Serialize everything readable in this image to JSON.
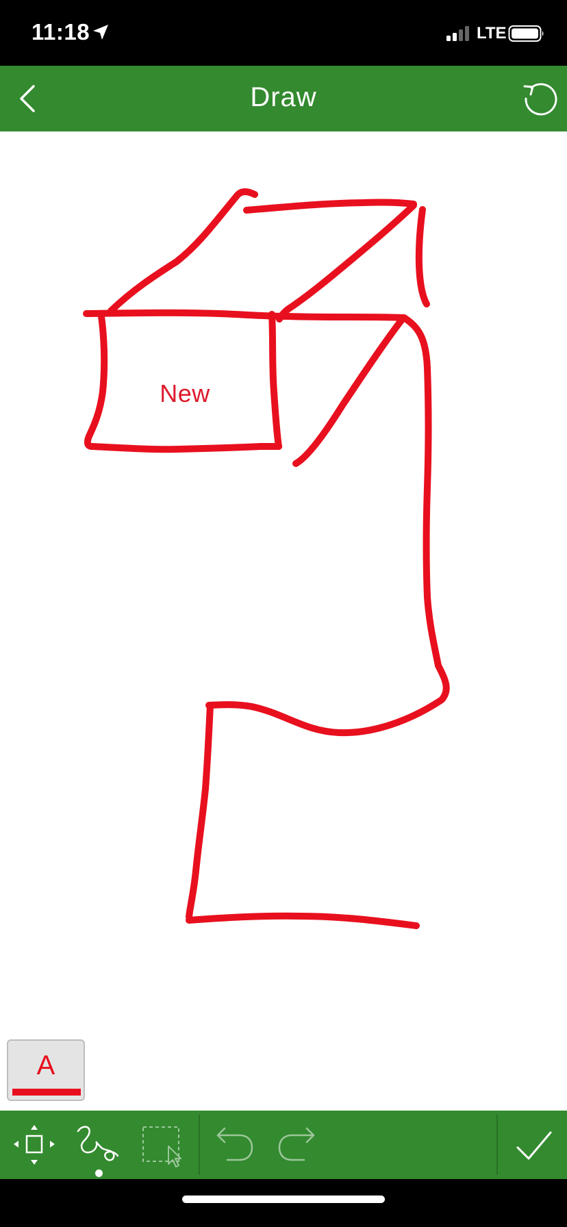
{
  "status_bar": {
    "time": "11:18",
    "network": "LTE",
    "location_icon": "location-arrow-icon",
    "signal_icon": "signal-bars-icon",
    "battery_icon": "battery-icon"
  },
  "header": {
    "title": "Draw",
    "back_icon": "chevron-left-icon",
    "reset_icon": "rotate-reset-icon",
    "background_color": "#338a2f"
  },
  "canvas": {
    "text_label": "New",
    "stroke_color": "#e8101e"
  },
  "text_style": {
    "letter": "A",
    "color": "#e8101e"
  },
  "toolbar": {
    "tools": [
      {
        "name": "move",
        "icon": "move-arrows-icon",
        "active": false
      },
      {
        "name": "freehand",
        "icon": "freehand-scribble-icon",
        "active": true
      },
      {
        "name": "select",
        "icon": "selection-box-icon",
        "active": false
      },
      {
        "name": "undo",
        "icon": "undo-arrow-icon",
        "active": false
      },
      {
        "name": "redo",
        "icon": "redo-arrow-icon",
        "active": false
      },
      {
        "name": "done",
        "icon": "checkmark-icon",
        "active": false
      }
    ],
    "background_color": "#338a2f"
  }
}
